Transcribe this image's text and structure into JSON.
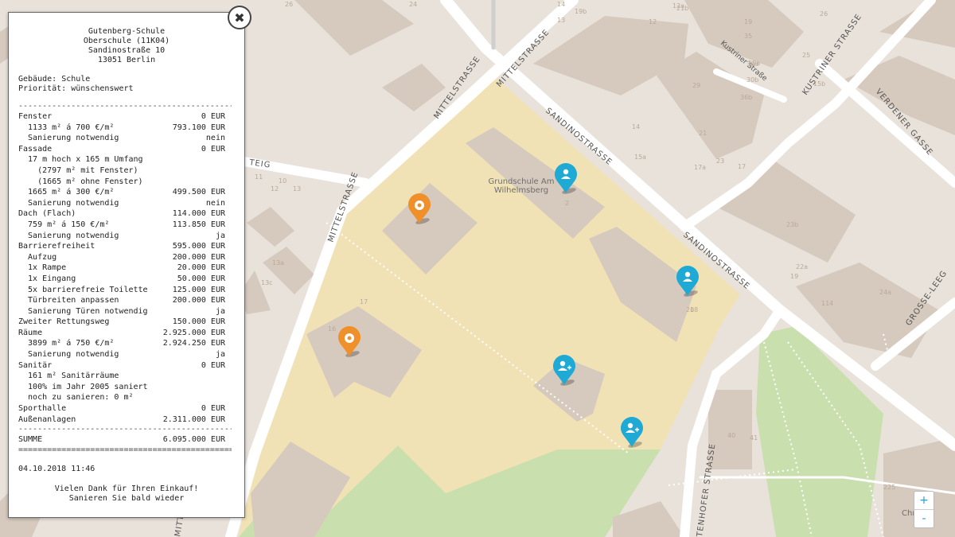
{
  "map": {
    "streets": {
      "mittelstrasse_a": "MITTELSTRASSE",
      "mittelstrasse_b": "MITTELSTRASSE",
      "mittelstrasse_c": "MITTELSTRASSE",
      "sandinostrasse_a": "SANDINOSTRASSE",
      "sandinostrasse_b": "SANDINOSTRASSE",
      "kustriner_strasse_a": "KUSTRINER STRASSE",
      "kustriner_strasse_b": "Kustriner Straße",
      "verdener_gasse": "VERDENER GASSE",
      "grosse_leege": "GROSSE-LEEG",
      "tenhofer_strasse": "TENHOFER STRASSE",
      "steig": "TEIG",
      "mitte_bottom": "MITTE"
    },
    "poi": {
      "line1": "Grundschule Am",
      "line2": "Wilhelmsberg",
      "chr": "Chr"
    },
    "house_numbers": [
      "26",
      "24",
      "14",
      "13",
      "12",
      "12a",
      "19b",
      "21b",
      "19",
      "19a",
      "25",
      "26",
      "35",
      "30a",
      "30b",
      "29",
      "21",
      "36b",
      "23",
      "17",
      "14",
      "15a",
      "15b",
      "17a",
      "2",
      "16",
      "17",
      "18",
      "19",
      "13a",
      "13c",
      "10",
      "11",
      "12",
      "13",
      "24a",
      "23b",
      "22a",
      "114",
      "225",
      "40",
      "41",
      "20"
    ],
    "markers": [
      {
        "type": "school",
        "color": "#f0902a"
      },
      {
        "type": "school",
        "color": "#f0902a"
      },
      {
        "type": "person",
        "color": "#1fa9d5"
      },
      {
        "type": "person",
        "color": "#1fa9d5"
      },
      {
        "type": "person-add",
        "color": "#1fa9d5"
      },
      {
        "type": "person-add",
        "color": "#1fa9d5"
      }
    ]
  },
  "receipt": {
    "header": [
      "Gutenberg-Schule",
      "Oberschule (11K04)",
      "Sandinostraße 10",
      "13051 Berlin"
    ],
    "building_label": "Gebäude:",
    "building_value": "Schule",
    "priority_label": "Priorität:",
    "priority_value": "wünschenswert",
    "separator_dash": "---------------------------------------------",
    "separator_eq": "=============================================",
    "lines": [
      {
        "label": "Fenster",
        "value": "0 EUR"
      },
      {
        "label": "  1133 m² á 700 €/m²",
        "value": "793.100 EUR"
      },
      {
        "label": "  Sanierung notwendig",
        "value": "nein"
      },
      {
        "label": "Fassade",
        "value": "0 EUR"
      },
      {
        "label": "  17 m hoch x 165 m Umfang",
        "value": ""
      },
      {
        "label": "    (2797 m² mit Fenster)",
        "value": ""
      },
      {
        "label": "    (1665 m² ohne Fenster)",
        "value": ""
      },
      {
        "label": "  1665 m² á 300 €/m²",
        "value": "499.500 EUR"
      },
      {
        "label": "  Sanierung notwendig",
        "value": "nein"
      },
      {
        "label": "Dach (Flach)",
        "value": "114.000 EUR"
      },
      {
        "label": "  759 m² á 150 €/m²",
        "value": "113.850 EUR"
      },
      {
        "label": "  Sanierung notwendig",
        "value": "ja"
      },
      {
        "label": "Barrierefreiheit",
        "value": "595.000 EUR"
      },
      {
        "label": "  Aufzug",
        "value": "200.000 EUR"
      },
      {
        "label": "  1x Rampe",
        "value": "20.000 EUR"
      },
      {
        "label": "  1x Eingang",
        "value": "50.000 EUR"
      },
      {
        "label": "  5x barrierefreie Toilette",
        "value": "125.000 EUR"
      },
      {
        "label": "  Türbreiten anpassen",
        "value": "200.000 EUR"
      },
      {
        "label": "  Sanierung Türen notwendig",
        "value": "ja"
      },
      {
        "label": "Zweiter Rettungsweg",
        "value": "150.000 EUR"
      },
      {
        "label": "Räume",
        "value": "2.925.000 EUR"
      },
      {
        "label": "  3899 m² á 750 €/m²",
        "value": "2.924.250 EUR"
      },
      {
        "label": "  Sanierung notwendig",
        "value": "ja"
      },
      {
        "label": "Sanitär",
        "value": "0 EUR"
      },
      {
        "label": "  161 m² Sanitärräume",
        "value": ""
      },
      {
        "label": "  100% im Jahr 2005 saniert",
        "value": ""
      },
      {
        "label": "  noch zu sanieren: 0 m²",
        "value": ""
      },
      {
        "label": "Sporthalle",
        "value": "0 EUR"
      },
      {
        "label": "Außenanlagen",
        "value": "2.311.000 EUR"
      }
    ],
    "sum_label": "SUMME",
    "sum_value": "6.095.000 EUR",
    "datetime": "04.10.2018 11:46",
    "thanks1": "Vielen Dank für Ihren Einkauf!",
    "thanks2": "Sanieren Sie bald wieder",
    "close_icon": "✖"
  },
  "zoom": {
    "in": "+",
    "out": "-"
  },
  "colors": {
    "school_area": "#f1e2b6",
    "park": "#c9dfae",
    "building": "#d6c9bd",
    "road": "#ffffff",
    "accent": "#1fa9d5",
    "school_marker": "#f0902a"
  }
}
